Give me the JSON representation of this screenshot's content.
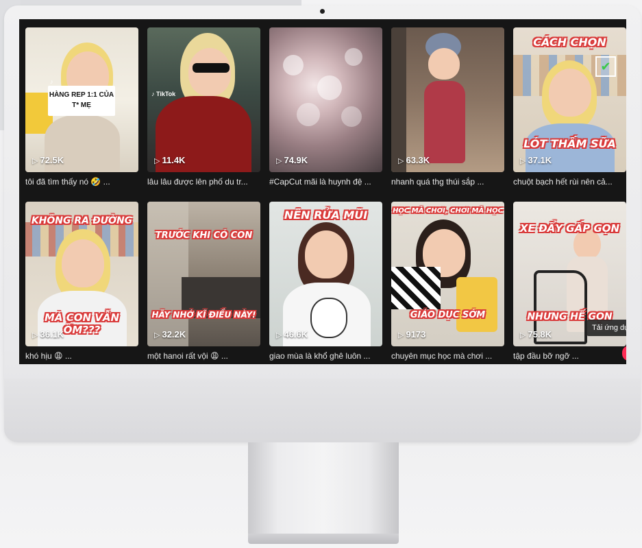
{
  "screen": {
    "videos": [
      {
        "views": "72.5K",
        "caption": "tôi đã tìm thấy nó 🤣 ...",
        "overlay_top": "",
        "overlay_bottom": "",
        "sign": "HÀNG REP 1:1 CỦA T* MẸ"
      },
      {
        "views": "11.4K",
        "caption": "lâu lâu được lên phố du tr...",
        "overlay_top": "",
        "overlay_bottom": "",
        "watermark": "TikTok"
      },
      {
        "views": "74.9K",
        "caption": "#CapCut mãi là huynh đệ ...",
        "overlay_top": "",
        "overlay_bottom": ""
      },
      {
        "views": "63.3K",
        "caption": "nhanh quá  thg thúi sắp ...",
        "overlay_top": "",
        "overlay_bottom": ""
      },
      {
        "views": "37.1K",
        "caption": "chuột bạch hết rùi nên cả...",
        "overlay_top": "CÁCH CHỌN",
        "overlay_bottom": "LÓT THẤM SỮA"
      },
      {
        "views": "36.1K",
        "caption": "khó hịu 😩 ...",
        "overlay_top": "KHÔNG RA ĐƯỜNG",
        "overlay_bottom": "MÀ CON VẪN ỐM???"
      },
      {
        "views": "32.2K",
        "caption": "một hanoi rất vội 😩 ...",
        "overlay_top": "TRƯỚC KHI CÓ CON",
        "overlay_bottom": "HÃY NHỚ KĨ ĐIỀU NÀY!"
      },
      {
        "views": "46.6K",
        "caption": "giao mùa là khổ ghê luôn ...",
        "overlay_top": "NÊN RỬA MŨI",
        "overlay_bottom": ""
      },
      {
        "views": "9173",
        "caption": "chuyên mục học mà chơi ...",
        "overlay_top": "HỌC MÀ CHƠI, CHƠI MÀ HỌC",
        "overlay_bottom": "GIÁO DỤC SỚM"
      },
      {
        "views": "75.8K",
        "caption": "tập đầu bỡ ngỡ  ...",
        "overlay_top": "XE ĐẨY GẤP GỌN",
        "overlay_bottom": "NHƯNG  HẾ GỌN"
      }
    ],
    "download_tip": "Tải ứng dụ"
  },
  "colors": {
    "accent": "#fe2c55",
    "overlay_red": "#d93a3a",
    "screen_bg": "#161616"
  },
  "icons": {
    "play": "play-icon",
    "check": "check-icon"
  }
}
